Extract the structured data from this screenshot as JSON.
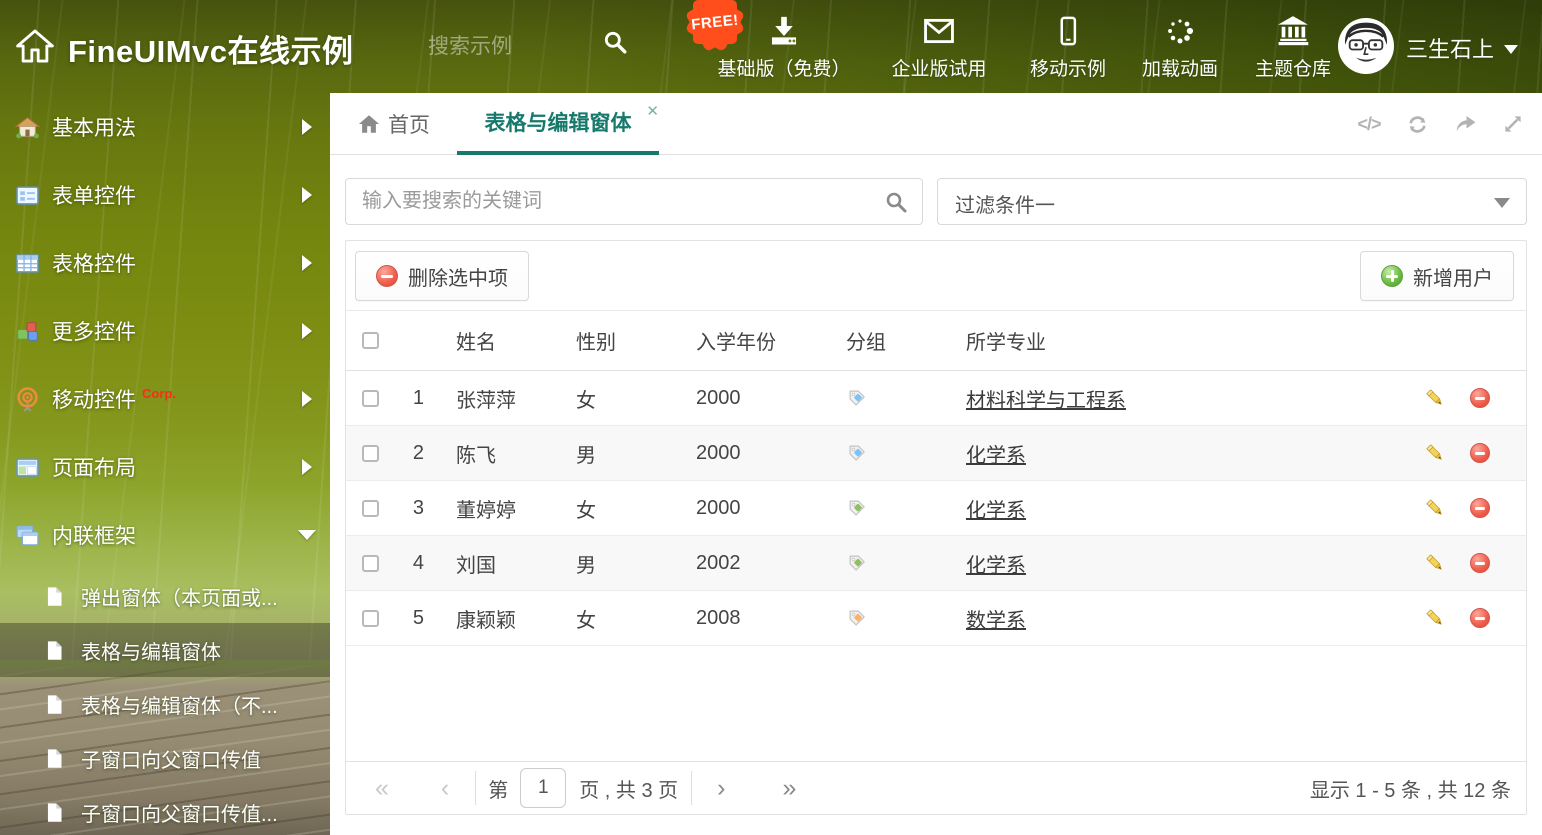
{
  "header": {
    "title": "FineUIMvc在线示例",
    "search_placeholder": "搜索示例",
    "free_badge": "FREE!",
    "nav": [
      {
        "label": "基础版（免费）"
      },
      {
        "label": "企业版试用"
      },
      {
        "label": "移动示例"
      },
      {
        "label": "加载动画"
      },
      {
        "label": "主题仓库"
      }
    ],
    "username": "三生石上"
  },
  "sidebar": {
    "items": [
      {
        "label": "基本用法"
      },
      {
        "label": "表单控件"
      },
      {
        "label": "表格控件"
      },
      {
        "label": "更多控件"
      },
      {
        "label": "移动控件",
        "badge": "Corp."
      },
      {
        "label": "页面布局"
      },
      {
        "label": "内联框架"
      }
    ],
    "subitems": [
      {
        "label": "弹出窗体（本页面或..."
      },
      {
        "label": "表格与编辑窗体"
      },
      {
        "label": "表格与编辑窗体（不..."
      },
      {
        "label": "子窗口向父窗口传值"
      },
      {
        "label": "子窗口向父窗口传值..."
      }
    ]
  },
  "tabs": {
    "home": "首页",
    "active": "表格与编辑窗体",
    "close": "✕",
    "code_icon_text": "</>"
  },
  "filterbar": {
    "search_placeholder": "输入要搜索的关键词",
    "filter_value": "过滤条件一"
  },
  "toolbar": {
    "delete_label": "删除选中项",
    "add_label": "新增用户"
  },
  "table": {
    "columns": {
      "name": "姓名",
      "gender": "性别",
      "year": "入学年份",
      "group": "分组",
      "major": "所学专业"
    },
    "rows": [
      {
        "num": "1",
        "name": "张萍萍",
        "gender": "女",
        "year": "2000",
        "tag": "blue",
        "major": "材料科学与工程系"
      },
      {
        "num": "2",
        "name": "陈飞",
        "gender": "男",
        "year": "2000",
        "tag": "blue",
        "major": "化学系"
      },
      {
        "num": "3",
        "name": "董婷婷",
        "gender": "女",
        "year": "2000",
        "tag": "green",
        "major": "化学系"
      },
      {
        "num": "4",
        "name": "刘国",
        "gender": "男",
        "year": "2002",
        "tag": "green",
        "major": "化学系"
      },
      {
        "num": "5",
        "name": "康颖颖",
        "gender": "女",
        "year": "2008",
        "tag": "orange",
        "major": "数学系"
      }
    ]
  },
  "pagination": {
    "first": "«",
    "prev": "‹",
    "next": "›",
    "last": "»",
    "page_prefix": "第",
    "page_value": "1",
    "page_suffix": "页 , 共 3 页",
    "summary": "显示 1 - 5 条 , 共 12 条"
  },
  "colors": {
    "accent_teal": "#17786c",
    "free_badge": "#ff4e1c",
    "corp_red": "#ff2a1a",
    "tag_blue": "#7cc2f4",
    "tag_green": "#8fbf62",
    "tag_orange": "#f8b36b"
  }
}
